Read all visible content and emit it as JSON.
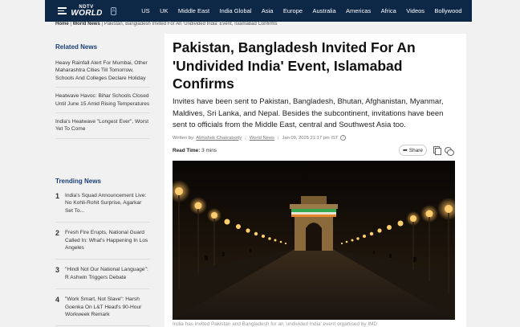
{
  "nav": {
    "logo_line1": "NDTV",
    "logo_line2": "WORLD",
    "links": [
      "US",
      "UK",
      "Middle East",
      "India Global",
      "Asia",
      "Europe",
      "Australia",
      "Americas",
      "Africa",
      "Videos",
      "Bollywood"
    ]
  },
  "breadcrumb": {
    "home": "Home",
    "section": "World News",
    "current": "Pakistan, Bangladesh Invited For An 'Undivided India' Event, Islamabad Confirms"
  },
  "sidebar": {
    "related_heading": "Related News",
    "related": [
      "Heavy Rainfall Alert For Mumbai, Other Maharashtra Cities Till Tomorrow, Schools And Colleges Declare Holiday",
      "Heatwave Havoc: Bihar Schools Closed Until June 15 Amid Rising Temperatures",
      "India's Heatwave \"Longest Ever\", Worst Yet To Come"
    ],
    "trending_heading": "Trending News",
    "trending": [
      {
        "num": "1",
        "text": "India's Squad Announcement Live: No Kohli-Rohit Surprise, Agarkar Set To..."
      },
      {
        "num": "2",
        "text": "Fresh Fire Erupts, National Guard Called In: What's Happening In Los Angeles"
      },
      {
        "num": "3",
        "text": "\"Hindi Not Our National Language\": R Ashwin Triggers Debate"
      },
      {
        "num": "4",
        "text": "\"Work Smart, Not Slave\": Harsh Goenka On L&T Head's 90-Hour Workweek Remark"
      }
    ]
  },
  "article": {
    "headline": "Pakistan, Bangladesh Invited For An 'Undivided India' Event, Islamabad Confirms",
    "summary": "Invites have been sent to Pakistan, Bangladesh, Bhutan, Afghanistan, Myanmar, Maldives, Sri Lanka, and Nepal. Besides the subcontinent, invitations have been sent to officials from the Middle East, central and Southwest Asia too.",
    "written_by_label": "Written by:",
    "author": "Abhishek Chakraborty",
    "category": "World News",
    "date": "Jan 09, 2025 21:17 pm IST",
    "read_time_label": "Read Time:",
    "read_time": "3 mins",
    "share_label": "Share",
    "caption": "India has invited Pakistan and Bangladesh for an 'undivided India' event organised by IMD"
  }
}
